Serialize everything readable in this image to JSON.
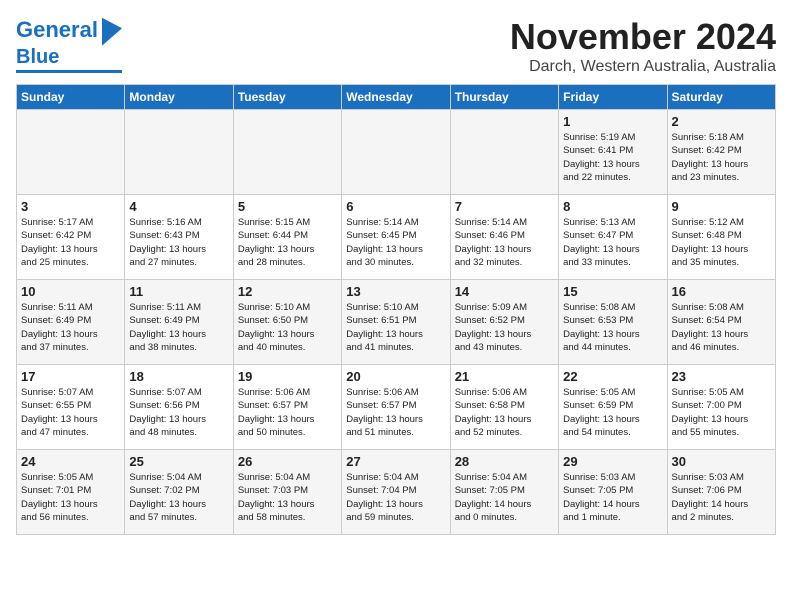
{
  "header": {
    "logo_general": "General",
    "logo_blue": "Blue",
    "title": "November 2024",
    "subtitle": "Darch, Western Australia, Australia"
  },
  "days_of_week": [
    "Sunday",
    "Monday",
    "Tuesday",
    "Wednesday",
    "Thursday",
    "Friday",
    "Saturday"
  ],
  "weeks": [
    [
      {
        "day": "",
        "info": ""
      },
      {
        "day": "",
        "info": ""
      },
      {
        "day": "",
        "info": ""
      },
      {
        "day": "",
        "info": ""
      },
      {
        "day": "",
        "info": ""
      },
      {
        "day": "1",
        "info": "Sunrise: 5:19 AM\nSunset: 6:41 PM\nDaylight: 13 hours\nand 22 minutes."
      },
      {
        "day": "2",
        "info": "Sunrise: 5:18 AM\nSunset: 6:42 PM\nDaylight: 13 hours\nand 23 minutes."
      }
    ],
    [
      {
        "day": "3",
        "info": "Sunrise: 5:17 AM\nSunset: 6:42 PM\nDaylight: 13 hours\nand 25 minutes."
      },
      {
        "day": "4",
        "info": "Sunrise: 5:16 AM\nSunset: 6:43 PM\nDaylight: 13 hours\nand 27 minutes."
      },
      {
        "day": "5",
        "info": "Sunrise: 5:15 AM\nSunset: 6:44 PM\nDaylight: 13 hours\nand 28 minutes."
      },
      {
        "day": "6",
        "info": "Sunrise: 5:14 AM\nSunset: 6:45 PM\nDaylight: 13 hours\nand 30 minutes."
      },
      {
        "day": "7",
        "info": "Sunrise: 5:14 AM\nSunset: 6:46 PM\nDaylight: 13 hours\nand 32 minutes."
      },
      {
        "day": "8",
        "info": "Sunrise: 5:13 AM\nSunset: 6:47 PM\nDaylight: 13 hours\nand 33 minutes."
      },
      {
        "day": "9",
        "info": "Sunrise: 5:12 AM\nSunset: 6:48 PM\nDaylight: 13 hours\nand 35 minutes."
      }
    ],
    [
      {
        "day": "10",
        "info": "Sunrise: 5:11 AM\nSunset: 6:49 PM\nDaylight: 13 hours\nand 37 minutes."
      },
      {
        "day": "11",
        "info": "Sunrise: 5:11 AM\nSunset: 6:49 PM\nDaylight: 13 hours\nand 38 minutes."
      },
      {
        "day": "12",
        "info": "Sunrise: 5:10 AM\nSunset: 6:50 PM\nDaylight: 13 hours\nand 40 minutes."
      },
      {
        "day": "13",
        "info": "Sunrise: 5:10 AM\nSunset: 6:51 PM\nDaylight: 13 hours\nand 41 minutes."
      },
      {
        "day": "14",
        "info": "Sunrise: 5:09 AM\nSunset: 6:52 PM\nDaylight: 13 hours\nand 43 minutes."
      },
      {
        "day": "15",
        "info": "Sunrise: 5:08 AM\nSunset: 6:53 PM\nDaylight: 13 hours\nand 44 minutes."
      },
      {
        "day": "16",
        "info": "Sunrise: 5:08 AM\nSunset: 6:54 PM\nDaylight: 13 hours\nand 46 minutes."
      }
    ],
    [
      {
        "day": "17",
        "info": "Sunrise: 5:07 AM\nSunset: 6:55 PM\nDaylight: 13 hours\nand 47 minutes."
      },
      {
        "day": "18",
        "info": "Sunrise: 5:07 AM\nSunset: 6:56 PM\nDaylight: 13 hours\nand 48 minutes."
      },
      {
        "day": "19",
        "info": "Sunrise: 5:06 AM\nSunset: 6:57 PM\nDaylight: 13 hours\nand 50 minutes."
      },
      {
        "day": "20",
        "info": "Sunrise: 5:06 AM\nSunset: 6:57 PM\nDaylight: 13 hours\nand 51 minutes."
      },
      {
        "day": "21",
        "info": "Sunrise: 5:06 AM\nSunset: 6:58 PM\nDaylight: 13 hours\nand 52 minutes."
      },
      {
        "day": "22",
        "info": "Sunrise: 5:05 AM\nSunset: 6:59 PM\nDaylight: 13 hours\nand 54 minutes."
      },
      {
        "day": "23",
        "info": "Sunrise: 5:05 AM\nSunset: 7:00 PM\nDaylight: 13 hours\nand 55 minutes."
      }
    ],
    [
      {
        "day": "24",
        "info": "Sunrise: 5:05 AM\nSunset: 7:01 PM\nDaylight: 13 hours\nand 56 minutes."
      },
      {
        "day": "25",
        "info": "Sunrise: 5:04 AM\nSunset: 7:02 PM\nDaylight: 13 hours\nand 57 minutes."
      },
      {
        "day": "26",
        "info": "Sunrise: 5:04 AM\nSunset: 7:03 PM\nDaylight: 13 hours\nand 58 minutes."
      },
      {
        "day": "27",
        "info": "Sunrise: 5:04 AM\nSunset: 7:04 PM\nDaylight: 13 hours\nand 59 minutes."
      },
      {
        "day": "28",
        "info": "Sunrise: 5:04 AM\nSunset: 7:05 PM\nDaylight: 14 hours\nand 0 minutes."
      },
      {
        "day": "29",
        "info": "Sunrise: 5:03 AM\nSunset: 7:05 PM\nDaylight: 14 hours\nand 1 minute."
      },
      {
        "day": "30",
        "info": "Sunrise: 5:03 AM\nSunset: 7:06 PM\nDaylight: 14 hours\nand 2 minutes."
      }
    ]
  ]
}
